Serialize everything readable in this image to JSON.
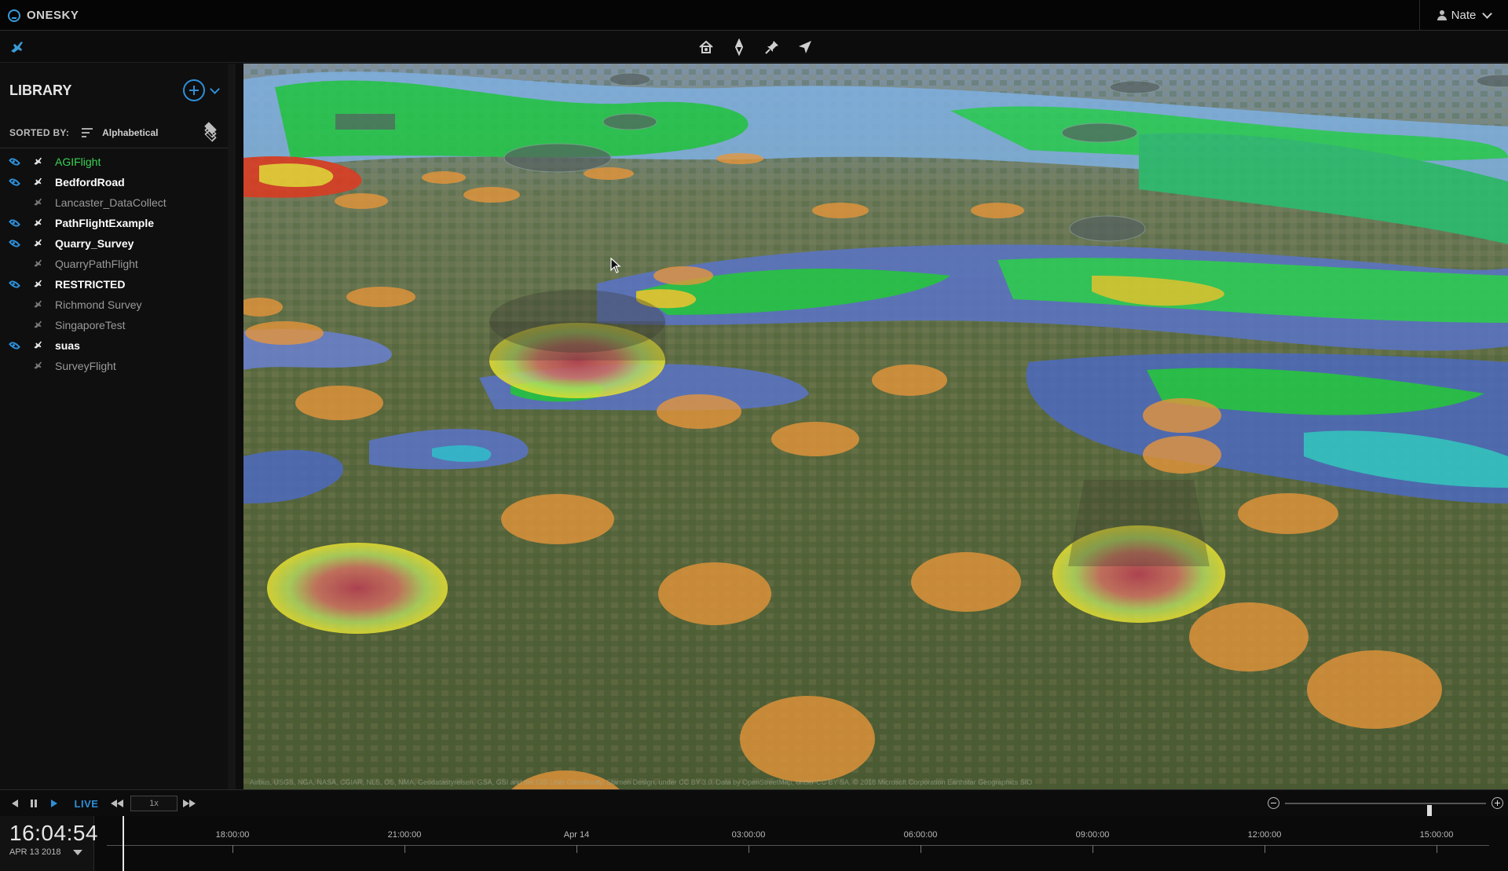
{
  "app": {
    "name": "ONESKY"
  },
  "user": {
    "name": "Nate"
  },
  "toolbar": {
    "tools": [
      "home-view-icon",
      "compass-icon",
      "pin-icon",
      "navigate-icon"
    ]
  },
  "library": {
    "title": "LIBRARY",
    "sort_label": "SORTED BY:",
    "sort_value": "Alphabetical",
    "flights": [
      {
        "name": "AGIFlight",
        "visible": true,
        "active": true
      },
      {
        "name": "BedfordRoad",
        "visible": true,
        "active": false
      },
      {
        "name": "Lancaster_DataCollect",
        "visible": false,
        "active": false
      },
      {
        "name": "PathFlightExample",
        "visible": true,
        "active": false
      },
      {
        "name": "Quarry_Survey",
        "visible": true,
        "active": false
      },
      {
        "name": "QuarryPathFlight",
        "visible": false,
        "active": false
      },
      {
        "name": "RESTRICTED",
        "visible": true,
        "active": false
      },
      {
        "name": "Richmond Survey",
        "visible": false,
        "active": false
      },
      {
        "name": "SingaporeTest",
        "visible": false,
        "active": false
      },
      {
        "name": "suas",
        "visible": true,
        "active": false
      },
      {
        "name": "SurveyFlight",
        "visible": false,
        "active": false
      }
    ]
  },
  "map": {
    "attribution": "Airbus, USGS, NGA, NASA, CGIAR, NLS, OS, NMA, Geodatastyrelsen, GSA, GSI and the GIS User Community; Stamen Design, under CC BY 3.0. Data by OpenStreetMap, under CC BY SA. © 2018 Microsoft Corporation  Earthstar Geographics SIO"
  },
  "playback": {
    "live_label": "LIVE",
    "speed": "1x",
    "zoom_level": 0.72
  },
  "timeline": {
    "time": "16:04:54",
    "date": "APR 13 2018",
    "ticks": [
      "18:00:00",
      "21:00:00",
      "Apr 14",
      "03:00:00",
      "06:00:00",
      "09:00:00",
      "12:00:00",
      "15:00:00"
    ]
  }
}
